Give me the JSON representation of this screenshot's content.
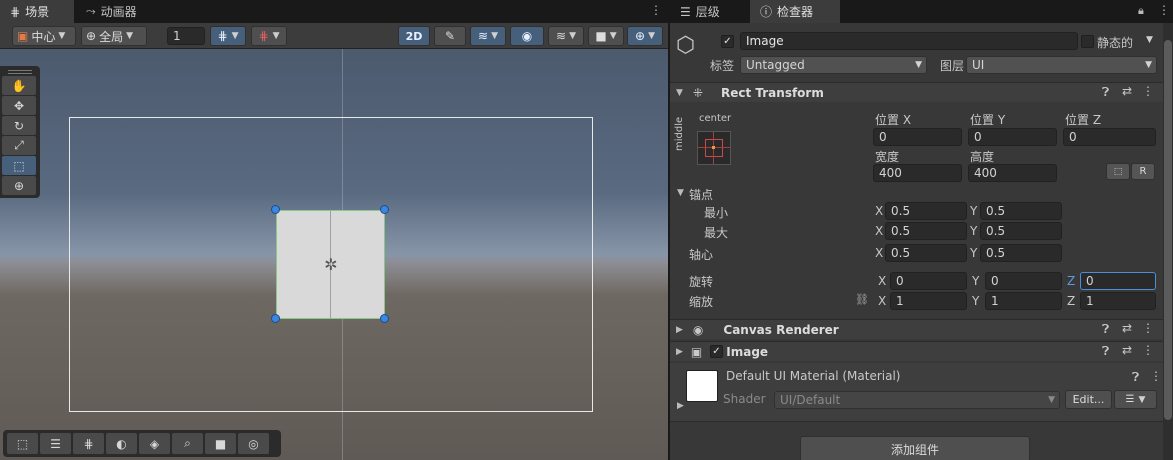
{
  "scene_tabs": [
    {
      "label": "场景",
      "icon": "grid-icon"
    },
    {
      "label": "动画器",
      "icon": "animator-icon"
    }
  ],
  "toolbar": {
    "pivot_label": "中心",
    "space_label": "全局",
    "grid_snap_value": "1",
    "mode_2d_label": "2D"
  },
  "tools": [
    "hand-tool",
    "move-tool",
    "rotate-tool",
    "scale-tool",
    "rect-tool",
    "transform-tool"
  ],
  "bottom_overlay": [
    "rect-tool",
    "ui-tool",
    "grid-tool",
    "lighting-tool",
    "layers-tool",
    "search-tool",
    "camera-tool",
    "compass-tool"
  ],
  "inspector_tabs": [
    {
      "label": "层级"
    },
    {
      "label": "检查器"
    }
  ],
  "object": {
    "active": true,
    "name": "Image",
    "static_label": "静态的",
    "static_checked": false,
    "tag_label": "标签",
    "tag_value": "Untagged",
    "layer_label": "图层",
    "layer_value": "UI"
  },
  "rect_transform": {
    "title": "Rect Transform",
    "anchor_h": "center",
    "anchor_v": "middle",
    "pos_x_label": "位置 X",
    "pos_y_label": "位置 Y",
    "pos_z_label": "位置 Z",
    "pos_x": "0",
    "pos_y": "0",
    "pos_z": "0",
    "width_label": "宽度",
    "height_label": "高度",
    "width": "400",
    "height": "400",
    "r_button": "R",
    "anchors_label": "锚点",
    "min_label": "最小",
    "max_label": "最大",
    "pivot_label": "轴心",
    "min_x": "0.5",
    "min_y": "0.5",
    "max_x": "0.5",
    "max_y": "0.5",
    "pivot_x": "0.5",
    "pivot_y": "0.5",
    "rotation_label": "旋转",
    "scale_label": "缩放",
    "rot_x": "0",
    "rot_y": "0",
    "rot_z": "0",
    "scale_x": "1",
    "scale_y": "1",
    "scale_z": "1",
    "axis_x": "X",
    "axis_y": "Y",
    "axis_z": "Z"
  },
  "canvas_renderer": {
    "title": "Canvas Renderer"
  },
  "image_component": {
    "title": "Image",
    "enabled": true
  },
  "material": {
    "name": "Default UI Material (Material)",
    "shader_label": "Shader",
    "shader_value": "UI/Default",
    "edit_label": "Edit..."
  },
  "add_component_label": "添加组件",
  "colors": {
    "accent": "#46607c",
    "focus": "#4a8fd8",
    "handle": "#3a86e0"
  }
}
